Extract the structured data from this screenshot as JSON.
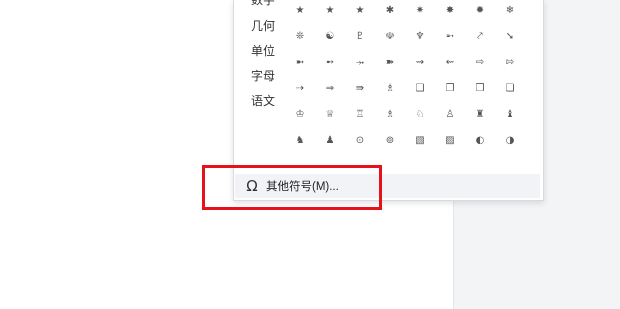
{
  "categories": [
    "数字",
    "几何",
    "单位",
    "字母",
    "语文"
  ],
  "symbol_rows": [
    [
      "★",
      "★",
      "★",
      "✱",
      "✷",
      "✸",
      "✹",
      "❄"
    ],
    [
      "❊",
      "☯",
      "♇",
      "☫",
      "♆",
      "➵",
      "⤤",
      "➘"
    ],
    [
      "➼",
      "➻",
      "⤞",
      "➽",
      "⇝",
      "⇜",
      "⇨",
      "⇰"
    ],
    [
      "⇢",
      "⇒",
      "⇛",
      "♗",
      "❑",
      "❐",
      "❒",
      "❏"
    ],
    [
      "♔",
      "♕",
      "♖",
      "♗",
      "♘",
      "♙",
      "♜",
      "♝"
    ],
    [
      "♞",
      "♟",
      "⊙",
      "⊚",
      "▧",
      "▨",
      "◐",
      "◑"
    ]
  ],
  "more_symbols": {
    "icon": "omega-icon",
    "glyph": "Ω",
    "label": "其他符号(M)..."
  },
  "colors": {
    "highlight": "#e5121b",
    "popup_footer_bg": "#f1f3f6",
    "gutter_bg": "#f3f4f6"
  }
}
